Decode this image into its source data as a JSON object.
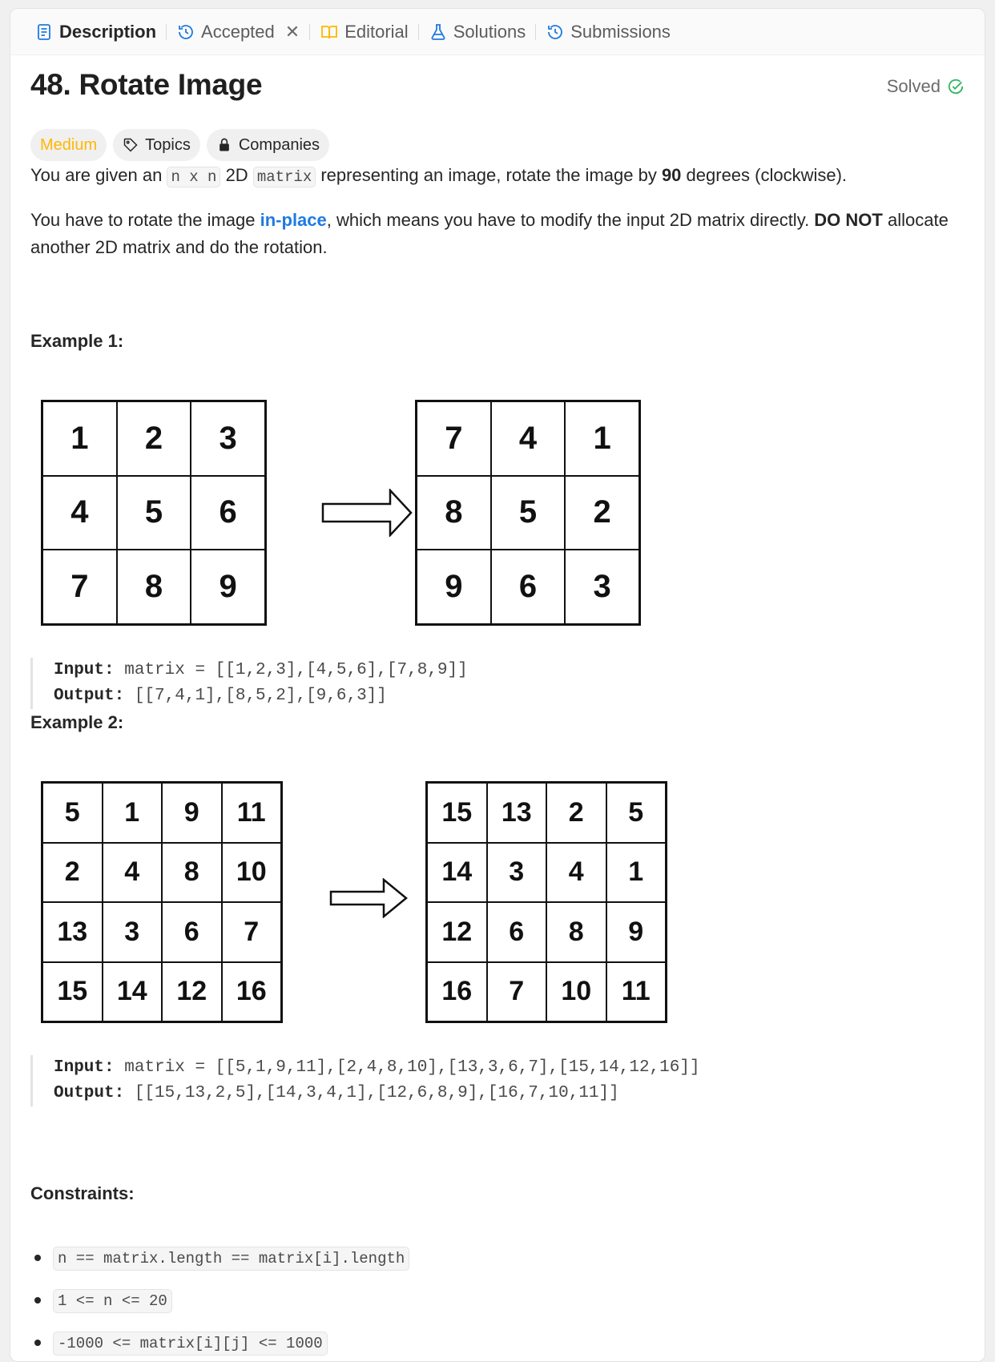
{
  "tabs": [
    {
      "label": "Description",
      "icon": "description-icon",
      "active": true
    },
    {
      "label": "Accepted",
      "icon": "history-icon",
      "closable": true
    },
    {
      "label": "Editorial",
      "icon": "book-icon"
    },
    {
      "label": "Solutions",
      "icon": "flask-icon"
    },
    {
      "label": "Submissions",
      "icon": "history-icon"
    }
  ],
  "problem": {
    "title": "48. Rotate Image",
    "status": "Solved",
    "difficulty": "Medium",
    "topics_label": "Topics",
    "companies_label": "Companies"
  },
  "description": {
    "p1_a": "You are given an ",
    "p1_code1": "n x n",
    "p1_b": " 2D ",
    "p1_code2": "matrix",
    "p1_c": " representing an image, rotate the image by ",
    "p1_bold": "90",
    "p1_d": " degrees (clockwise).",
    "p2_a": "You have to rotate the image ",
    "p2_link": "in-place",
    "p2_b": ", which means you have to modify the input 2D matrix directly. ",
    "p2_bold": "DO NOT",
    "p2_c": " allocate another 2D matrix and do the rotation."
  },
  "examples": [
    {
      "heading": "Example 1:",
      "input_label": "Input:",
      "input_value": "matrix = [[1,2,3],[4,5,6],[7,8,9]]",
      "output_label": "Output:",
      "output_value": "[[7,4,1],[8,5,2],[9,6,3]]",
      "input_grid": [
        "1",
        "2",
        "3",
        "4",
        "5",
        "6",
        "7",
        "8",
        "9"
      ],
      "output_grid": [
        "7",
        "4",
        "1",
        "8",
        "5",
        "2",
        "9",
        "6",
        "3"
      ]
    },
    {
      "heading": "Example 2:",
      "input_label": "Input:",
      "input_value": "matrix = [[5,1,9,11],[2,4,8,10],[13,3,6,7],[15,14,12,16]]",
      "output_label": "Output:",
      "output_value": "[[15,13,2,5],[14,3,4,1],[12,6,8,9],[16,7,10,11]]",
      "input_grid": [
        "5",
        "1",
        "9",
        "11",
        "2",
        "4",
        "8",
        "10",
        "13",
        "3",
        "6",
        "7",
        "15",
        "14",
        "12",
        "16"
      ],
      "output_grid": [
        "15",
        "13",
        "2",
        "5",
        "14",
        "3",
        "4",
        "1",
        "12",
        "6",
        "8",
        "9",
        "16",
        "7",
        "10",
        "11"
      ]
    }
  ],
  "constraints": {
    "heading": "Constraints:",
    "items": [
      "n == matrix.length == matrix[i].length",
      "1 <= n <= 20",
      "-1000 <= matrix[i][j] <= 1000"
    ]
  },
  "colors": {
    "accent": "#1f7ae0",
    "medium": "#ffb800",
    "solved": "#2db55d"
  }
}
